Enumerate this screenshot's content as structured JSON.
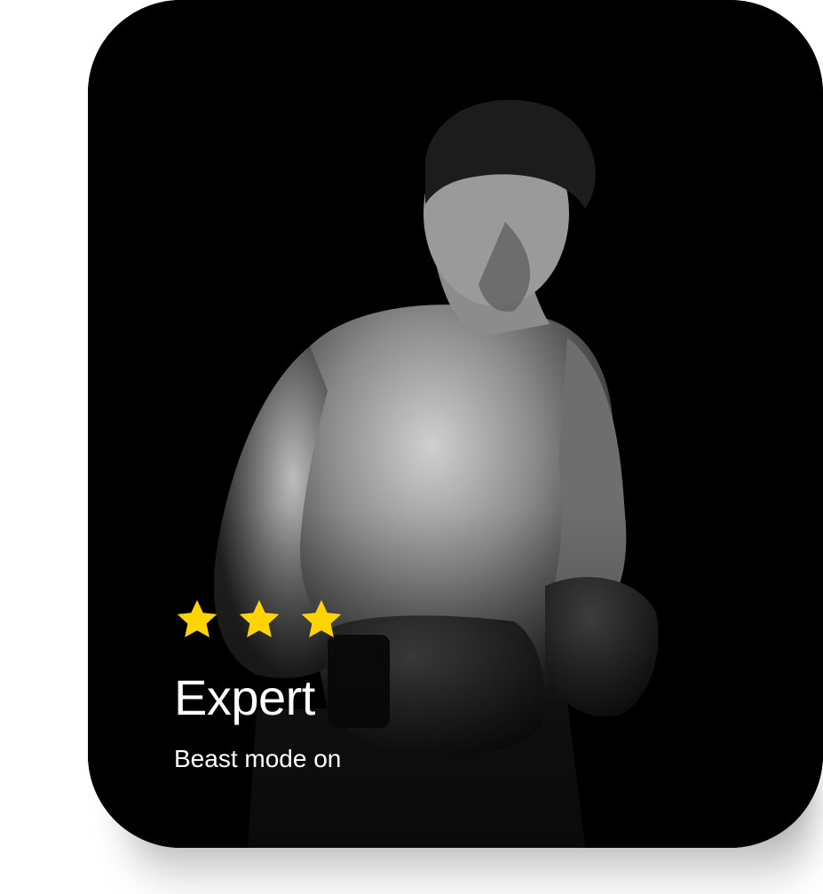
{
  "card": {
    "level_title": "Expert",
    "subtitle": "Beast mode on",
    "rating": 3,
    "star_color": "#FFD400",
    "background_color": "#000000",
    "image": "boxer-photo"
  }
}
